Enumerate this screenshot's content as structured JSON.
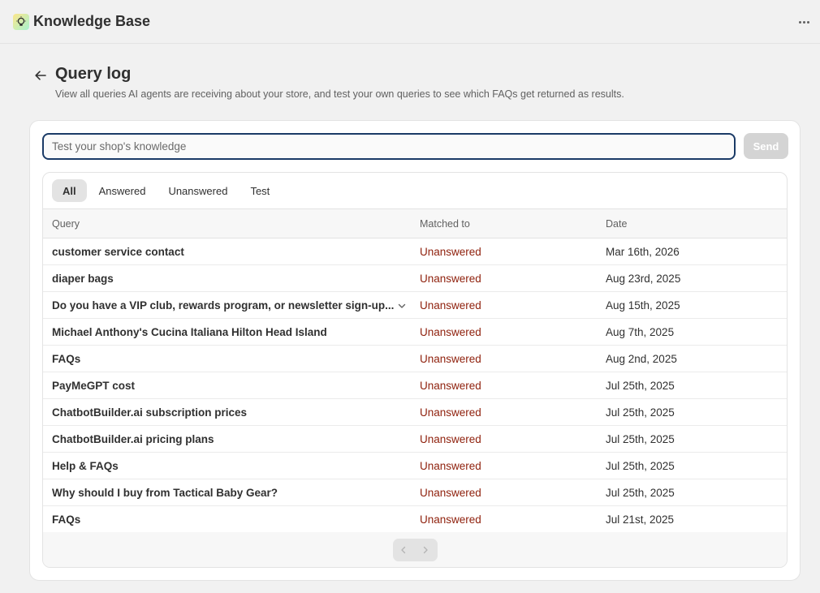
{
  "app": {
    "title": "Knowledge Base",
    "icon": "lightbulb-icon"
  },
  "header": {
    "title": "Query log",
    "subtitle": "View all queries AI agents are receiving about your store, and test your own queries to see which FAQs get returned as results."
  },
  "test": {
    "placeholder": "Test your shop's knowledge",
    "value": "",
    "send_label": "Send"
  },
  "tabs": [
    {
      "label": "All",
      "active": true
    },
    {
      "label": "Answered",
      "active": false
    },
    {
      "label": "Unanswered",
      "active": false
    },
    {
      "label": "Test",
      "active": false
    }
  ],
  "table": {
    "columns": [
      "Query",
      "Matched to",
      "Date"
    ],
    "rows": [
      {
        "query": "customer service contact",
        "matched": "Unanswered",
        "date": "Mar 16th, 2026"
      },
      {
        "query": "diaper bags",
        "matched": "Unanswered",
        "date": "Aug 23rd, 2025"
      },
      {
        "query": "Do you have a VIP club, rewards program, or newsletter sign-up...",
        "matched": "Unanswered",
        "date": "Aug 15th, 2025",
        "expandable": true
      },
      {
        "query": "Michael Anthony's Cucina Italiana Hilton Head Island",
        "matched": "Unanswered",
        "date": "Aug 7th, 2025"
      },
      {
        "query": "FAQs",
        "matched": "Unanswered",
        "date": "Aug 2nd, 2025"
      },
      {
        "query": "PayMeGPT cost",
        "matched": "Unanswered",
        "date": "Jul 25th, 2025"
      },
      {
        "query": "ChatbotBuilder.ai subscription prices",
        "matched": "Unanswered",
        "date": "Jul 25th, 2025"
      },
      {
        "query": "ChatbotBuilder.ai pricing plans",
        "matched": "Unanswered",
        "date": "Jul 25th, 2025"
      },
      {
        "query": "Help & FAQs",
        "matched": "Unanswered",
        "date": "Jul 25th, 2025"
      },
      {
        "query": "Why should I buy from Tactical Baby Gear?",
        "matched": "Unanswered",
        "date": "Jul 25th, 2025"
      },
      {
        "query": "FAQs",
        "matched": "Unanswered",
        "date": "Jul 21st, 2025"
      }
    ]
  },
  "colors": {
    "unanswered": "#8e1f0b",
    "input_border": "#1a3a66",
    "send_disabled": "#d4d4d4"
  }
}
